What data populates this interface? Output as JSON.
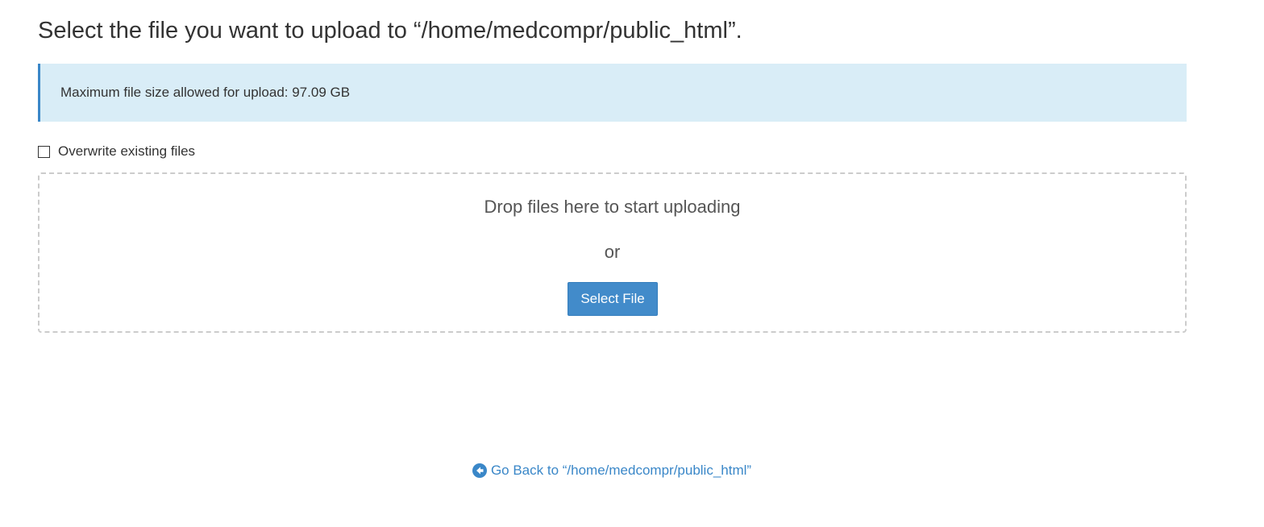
{
  "header": {
    "title": "Select the file you want to upload to “/home/medcompr/public_html”."
  },
  "alert": {
    "text": "Maximum file size allowed for upload: 97.09 GB"
  },
  "options": {
    "overwrite_label": "Overwrite existing files",
    "overwrite_checked": false
  },
  "dropzone": {
    "drop_text": "Drop files here to start uploading",
    "or_text": "or",
    "select_button_label": "Select File"
  },
  "footer": {
    "go_back_label": "Go Back to “/home/medcompr/public_html”",
    "go_back_icon": "arrow-circle-left-icon"
  },
  "colors": {
    "accent": "#428bca",
    "alert_bg": "#d9edf7",
    "link": "#3a87c8"
  }
}
